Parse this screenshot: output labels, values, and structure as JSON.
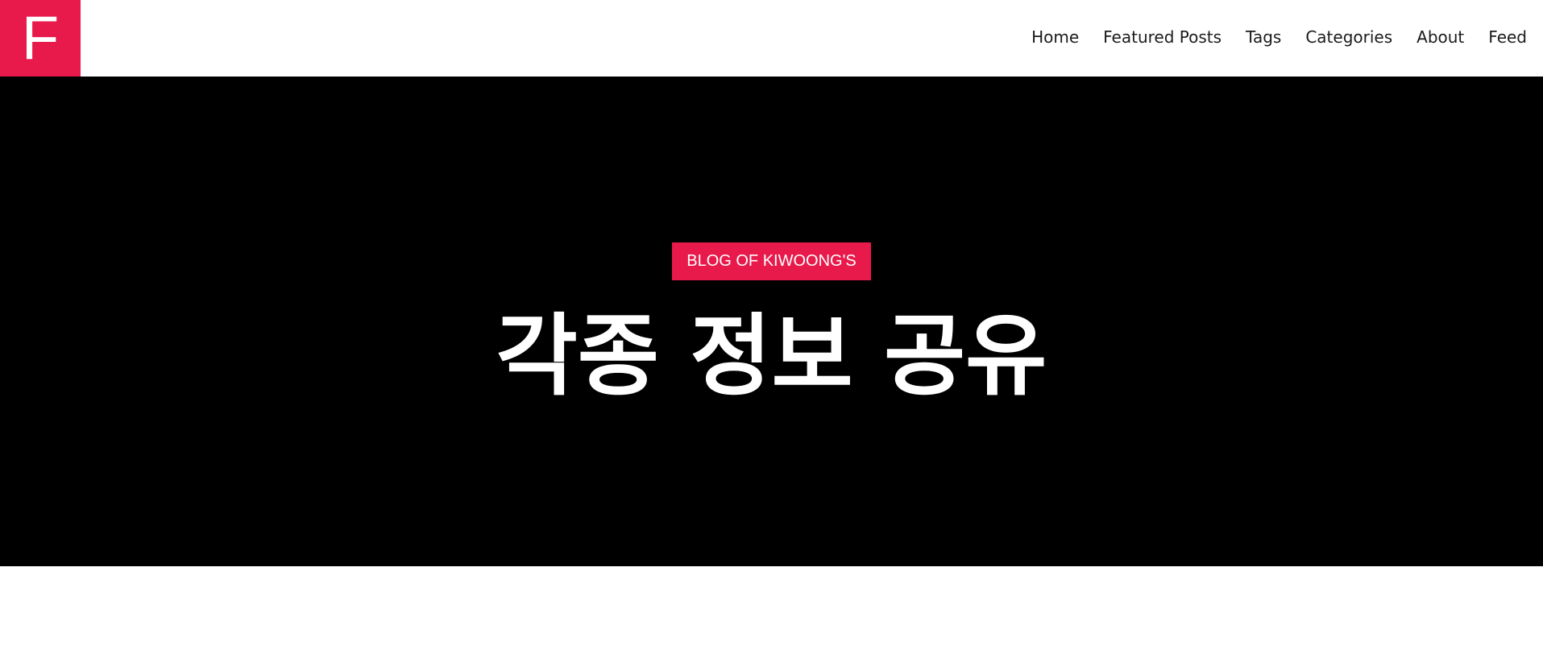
{
  "site": {
    "logo_letter": "F",
    "brand_color": "#e8194b"
  },
  "nav": {
    "items": [
      {
        "label": "Home"
      },
      {
        "label": "Featured Posts"
      },
      {
        "label": "Tags"
      },
      {
        "label": "Categories"
      },
      {
        "label": "About"
      },
      {
        "label": "Feed"
      }
    ]
  },
  "hero": {
    "badge": "BLOG OF KIWOONG'S",
    "title": "각종 정보 공유",
    "background": "#000000"
  }
}
